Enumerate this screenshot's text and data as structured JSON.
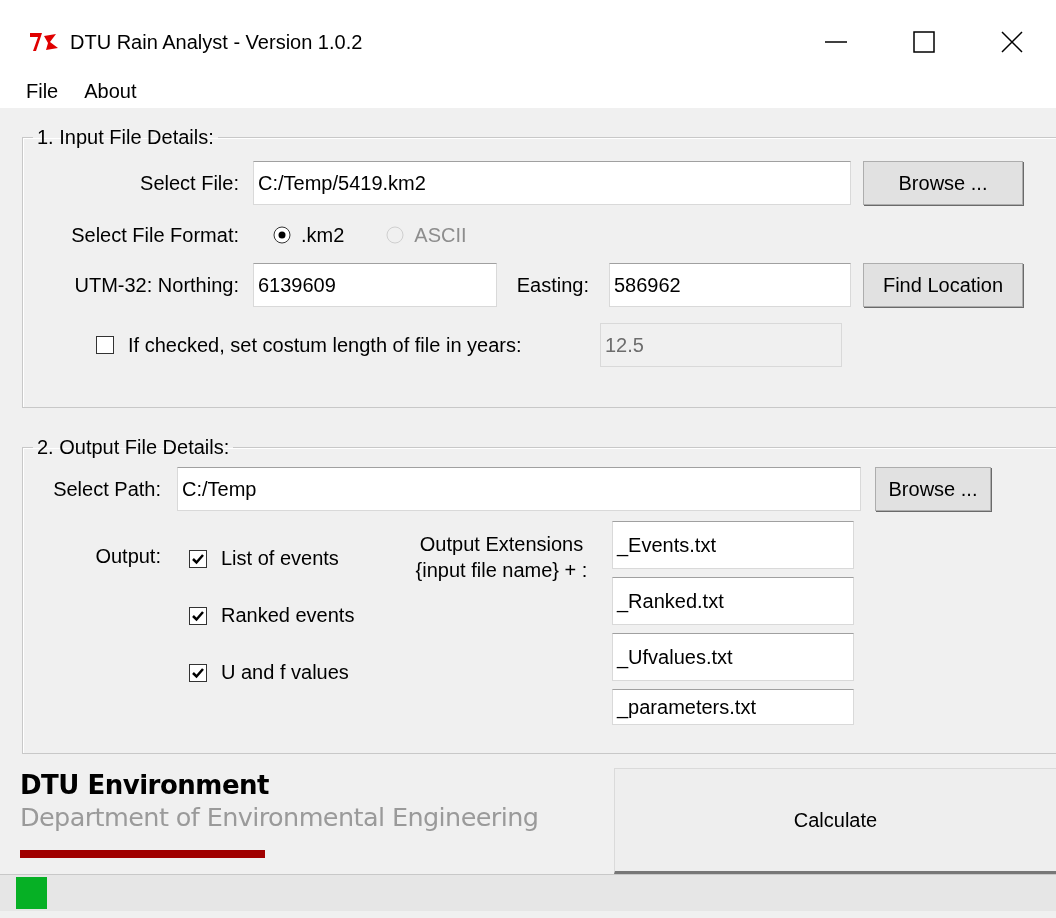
{
  "window": {
    "title": "DTU Rain Analyst - Version 1.0.2"
  },
  "menu": [
    "File",
    "About"
  ],
  "input_group": {
    "title": "1. Input File Details:",
    "file_label": "Select File:",
    "file_value": "C:/Temp/5419.km2",
    "browse": "Browse ...",
    "format_label": "Select File Format:",
    "formats": [
      {
        "label": ".km2",
        "selected": true,
        "disabled": false
      },
      {
        "label": "ASCII",
        "selected": false,
        "disabled": true
      }
    ],
    "northing_label": "UTM-32: Northing:",
    "northing_value": "6139609",
    "easting_label": "Easting:",
    "easting_value": "586962",
    "find_location": "Find Location",
    "custom_length": {
      "label": "If checked, set costum length of file in years:",
      "checked": false,
      "value": "12.5"
    }
  },
  "output_group": {
    "title": "2. Output File Details:",
    "path_label": "Select Path:",
    "path_value": "C:/Temp",
    "browse": "Browse ...",
    "output_label": "Output:",
    "outputs": [
      {
        "label": "List of events",
        "checked": true
      },
      {
        "label": "Ranked events",
        "checked": true
      },
      {
        "label": "U and f values",
        "checked": true
      }
    ],
    "extensions_label": [
      "Output Extensions",
      "{input file name} + :"
    ],
    "extensions": [
      "_Events.txt",
      "_Ranked.txt",
      "_Ufvalues.txt",
      "_parameters.txt"
    ]
  },
  "logo": {
    "name": "DTU Environment",
    "department": "Department of Environmental Engineering"
  },
  "calculate": "Calculate",
  "progress": {
    "level": 0.03
  }
}
